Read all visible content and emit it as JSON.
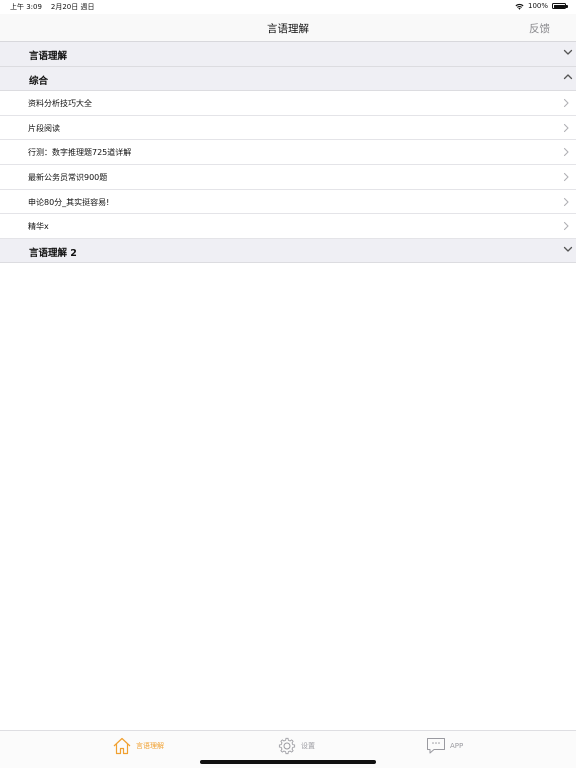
{
  "status_bar": {
    "time": "上午 3:09",
    "date": "2月20日 週日",
    "battery_percent": "100%",
    "battery_level": 1.0
  },
  "nav": {
    "title": "言语理解",
    "feedback_label": "反馈"
  },
  "sections": [
    {
      "label": "言语理解",
      "expanded": false,
      "items": []
    },
    {
      "label": "综合",
      "expanded": true,
      "items": [
        {
          "label": "资料分析技巧大全"
        },
        {
          "label": "片段阅读"
        },
        {
          "label": "行测：数字推理题725道详解"
        },
        {
          "label": "最新公务员常识900题"
        },
        {
          "label": "申论80分_其实挺容易!"
        },
        {
          "label": "精华x"
        }
      ]
    },
    {
      "label": "言语理解 2",
      "expanded": false,
      "items": []
    }
  ],
  "tab_bar": {
    "tabs": [
      {
        "label": "言语理解",
        "icon": "home-icon",
        "active": true
      },
      {
        "label": "设置",
        "icon": "gear-icon",
        "active": false
      },
      {
        "label": "APP",
        "icon": "chat-bubble-icon",
        "active": false
      }
    ],
    "active_color": "#f0a030",
    "inactive_color": "#9a9aa0"
  }
}
